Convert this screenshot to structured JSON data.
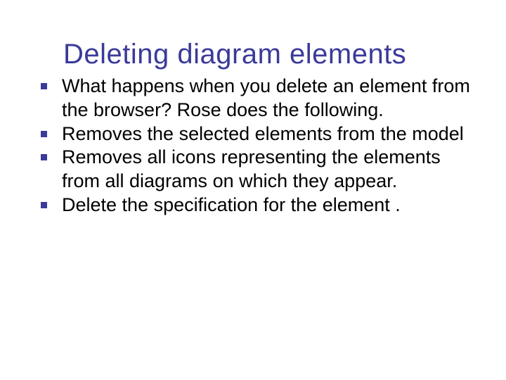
{
  "title": "Deleting diagram elements",
  "bullets": [
    "What happens when you delete an element from the browser? Rose does the following.",
    "Removes the selected elements from the model",
    "Removes all icons representing the elements from all diagrams on which they appear.",
    "Delete the specification for the element ."
  ]
}
